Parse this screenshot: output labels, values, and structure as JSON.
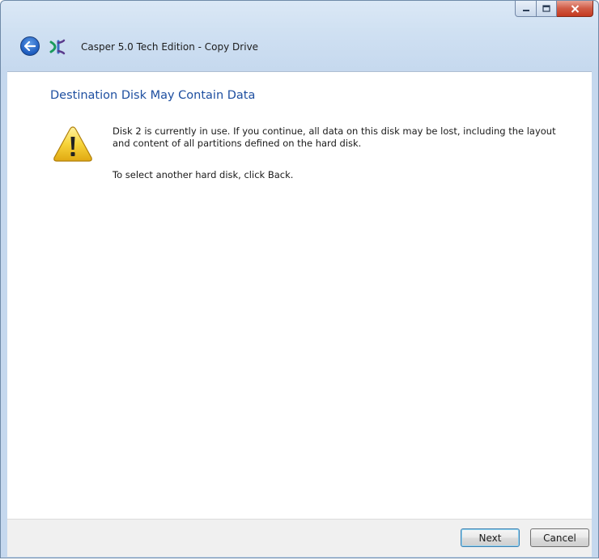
{
  "window": {
    "app_title": "Casper 5.0 Tech Edition - Copy Drive"
  },
  "icons": {
    "back": "back-arrow-icon",
    "app": "casper-app-icon",
    "warning": "warning-icon",
    "minimize": "minimize-icon",
    "maximize": "maximize-icon",
    "close": "close-icon"
  },
  "page": {
    "heading": "Destination Disk May Contain Data",
    "message": "Disk 2 is currently in use. If you continue, all data on this disk may be lost, including the layout and content of all partitions defined on the hard disk.",
    "hint": "To select another hard disk, click Back."
  },
  "footer": {
    "next_label": "Next",
    "cancel_label": "Cancel"
  },
  "colors": {
    "heading": "#1e4fa0",
    "window_frame": "#c5d8ee",
    "close_button": "#c4391f"
  }
}
